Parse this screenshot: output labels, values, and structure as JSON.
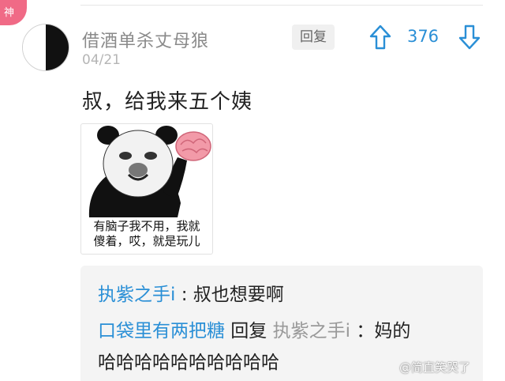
{
  "badge": {
    "label": "神"
  },
  "comment": {
    "username": "借酒单杀丈母狼",
    "date": "04/21",
    "reply_button": "回复",
    "vote_count": "376",
    "text": "叔，给我来五个姨",
    "meme": {
      "caption_line1": "有脑子我不用，我就",
      "caption_line2": "傻着，哎，就是玩儿"
    }
  },
  "replies": [
    {
      "user": "执紫之手i",
      "separator": " : ",
      "text": "叔也想要啊"
    },
    {
      "user": "口袋里有两把糖",
      "reply_word": " 回复 ",
      "reply_to": "执紫之手i",
      "separator": " ：",
      "text": "妈的",
      "text_line2": "哈哈哈哈哈哈哈哈哈哈"
    }
  ],
  "watermark": "@简直笑哭了",
  "colors": {
    "accent_blue": "#2a8fd6",
    "badge_pink": "#f06a86"
  },
  "icons": {
    "up": "arrow-up-icon",
    "down": "arrow-down-icon"
  }
}
